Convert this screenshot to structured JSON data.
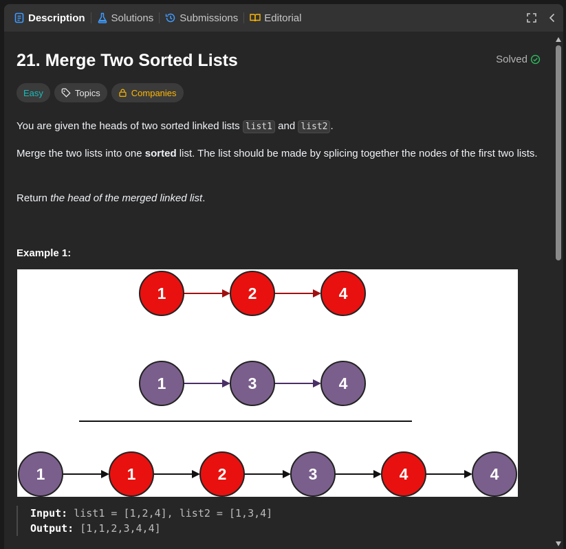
{
  "tabs": [
    {
      "label": "Description",
      "active": true,
      "icon": "description-icon"
    },
    {
      "label": "Solutions",
      "active": false,
      "icon": "flask-icon"
    },
    {
      "label": "Submissions",
      "active": false,
      "icon": "history-icon"
    },
    {
      "label": "Editorial",
      "active": false,
      "icon": "book-icon"
    }
  ],
  "problem": {
    "title": "21. Merge Two Sorted Lists",
    "status": "Solved",
    "difficulty": "Easy",
    "topics_label": "Topics",
    "companies_label": "Companies",
    "p1": {
      "pre": "You are given the heads of two sorted linked lists ",
      "code1": "list1",
      "mid": " and ",
      "code2": "list2",
      "post": "."
    },
    "p2": {
      "pre": "Merge the two lists into one ",
      "bold": "sorted",
      "post": " list. The list should be made by splicing together the nodes of the first two lists."
    },
    "p3": {
      "pre": "Return ",
      "em": "the head of the merged linked list",
      "post": "."
    },
    "example_title": "Example 1:",
    "example": {
      "input_label": "Input:",
      "input_value": "list1 = [1,2,4], list2 = [1,3,4]",
      "output_label": "Output:",
      "output_value": "[1,1,2,3,4,4]"
    }
  },
  "diagram": {
    "list1": [
      1,
      2,
      4
    ],
    "list2": [
      1,
      3,
      4
    ],
    "merged": [
      {
        "v": 1,
        "src": "list2"
      },
      {
        "v": 1,
        "src": "list1"
      },
      {
        "v": 2,
        "src": "list1"
      },
      {
        "v": 3,
        "src": "list2"
      },
      {
        "v": 4,
        "src": "list1"
      },
      {
        "v": 4,
        "src": "list2"
      }
    ]
  },
  "colors": {
    "accent": "#1cbaba",
    "companies": "#ffb800",
    "solved": "#2cbb5d",
    "node_list1": "#e8110f",
    "node_list2": "#7a5f8c"
  }
}
